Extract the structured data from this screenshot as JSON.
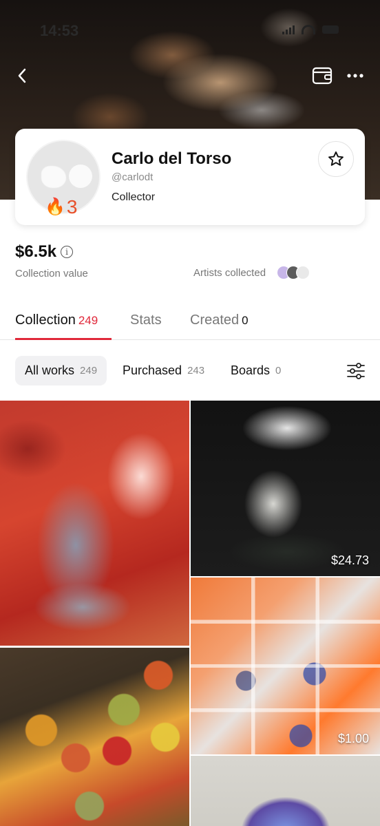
{
  "status_bar": {
    "time": "14:53"
  },
  "profile": {
    "name": "Carlo del Torso",
    "handle": "@carlodt",
    "role": "Collector",
    "streak_count": "3",
    "streak_icon": "fire-icon"
  },
  "stats": {
    "collection_value": "$6.5k",
    "collection_value_label": "Collection value",
    "artists_collected_label": "Artists collected"
  },
  "tabs": [
    {
      "label": "Collection",
      "count": "249",
      "active": true
    },
    {
      "label": "Stats",
      "count": "",
      "active": false
    },
    {
      "label": "Created",
      "count": "0",
      "active": false
    }
  ],
  "filters": [
    {
      "label": "All works",
      "count": "249",
      "active": true
    },
    {
      "label": "Purchased",
      "count": "243",
      "active": false
    },
    {
      "label": "Boards",
      "count": "0",
      "active": false
    }
  ],
  "artworks": [
    {
      "price": ""
    },
    {
      "price": "$24.73"
    },
    {
      "price": "$1.00"
    },
    {
      "price": ""
    },
    {
      "price": ""
    }
  ],
  "colors": {
    "accent": "#e0283a",
    "streak": "#e8502a"
  }
}
